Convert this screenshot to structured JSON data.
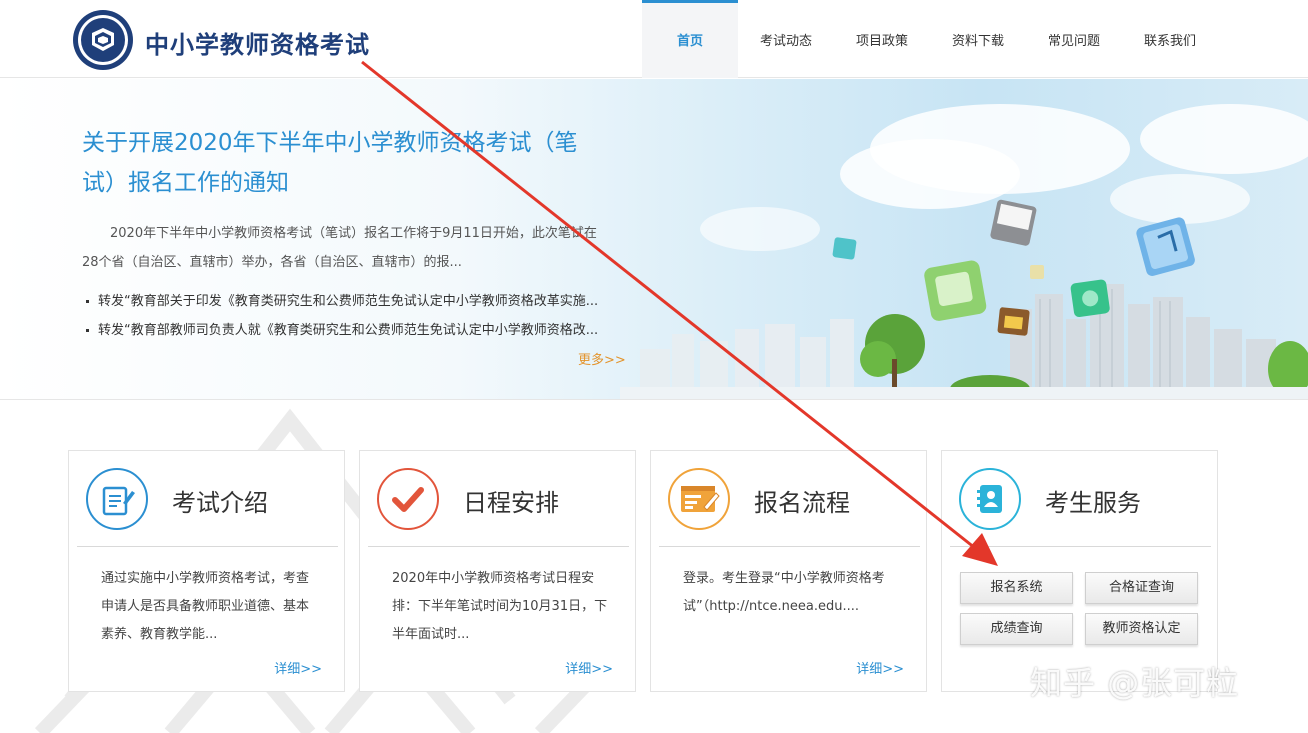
{
  "site": {
    "title": "中小学教师资格考试"
  },
  "nav": {
    "items": [
      {
        "label": "首页",
        "active": true
      },
      {
        "label": "考试动态",
        "active": false
      },
      {
        "label": "项目政策",
        "active": false
      },
      {
        "label": "资料下载",
        "active": false
      },
      {
        "label": "常见问题",
        "active": false
      },
      {
        "label": "联系我们",
        "active": false
      }
    ]
  },
  "banner": {
    "title": "关于开展2020年下半年中小学教师资格考试（笔试）报名工作的通知",
    "summary": "2020年下半年中小学教师资格考试（笔试）报名工作将于9月11日开始，此次笔试在28个省（自治区、直辖市）举办，各省（自治区、直辖市）的报...",
    "news": [
      "转发“教育部关于印发《教育类研究生和公费师范生免试认定中小学教师资格改革实施...",
      "转发“教育部教师司负责人就《教育类研究生和公费师范生免试认定中小学教师资格改..."
    ],
    "more": "更多>>"
  },
  "cards": [
    {
      "title": "考试介绍",
      "icon": "document-pen-icon",
      "color": "#2b8fd1",
      "text": "通过实施中小学教师资格考试，考查申请人是否具备教师职业道德、基本素养、教育教学能...",
      "more": "详细>>"
    },
    {
      "title": "日程安排",
      "icon": "checkmark-icon",
      "color": "#e2553b",
      "text": "2020年中小学教师资格考试日程安排：下半年笔试时间为10月31日，下半年面试时...",
      "more": "详细>>"
    },
    {
      "title": "报名流程",
      "icon": "browser-form-icon",
      "color": "#f0a33a",
      "text": "登录。考生登录“中小学教师资格考试”（http://ntce.neea.edu....",
      "more": "详细>>"
    },
    {
      "title": "考生服务",
      "icon": "contact-card-icon",
      "color": "#2bb3d9",
      "buttons": [
        "报名系统",
        "合格证查询",
        "成绩查询",
        "教师资格认定"
      ]
    }
  ],
  "watermark": "知乎 @张可粒",
  "colors": {
    "accent": "#2b8fd1",
    "title_navy": "#1f3f7a",
    "more_orange": "#e3932b",
    "arrow_red": "#e3372a"
  }
}
